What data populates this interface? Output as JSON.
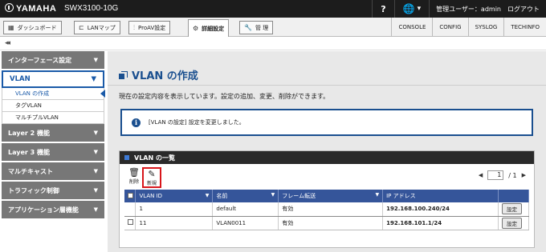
{
  "header": {
    "brand": "YAMAHA",
    "model": "SWX3100-10G",
    "help": "?",
    "user_label": "管理ユーザー：admin",
    "logout": "ログアウト"
  },
  "nav": {
    "tabs": [
      {
        "label": "ダッシュボード",
        "icon": "dashboard-icon"
      },
      {
        "label": "LANマップ",
        "icon": "lan-map-icon"
      },
      {
        "label": "ProAV設定",
        "icon": "sliders-icon"
      },
      {
        "label": "詳細設定",
        "icon": "gear-icon",
        "active": true
      },
      {
        "label": "管 理",
        "icon": "wrench-icon"
      }
    ],
    "links": [
      "CONSOLE",
      "CONFIG",
      "SYSLOG",
      "TECHINFO"
    ]
  },
  "collapse": "◂◂",
  "sidebar": {
    "sections": [
      {
        "label": "インターフェース設定"
      },
      {
        "label": "VLAN"
      },
      {
        "label": "Layer 2 機能"
      },
      {
        "label": "Layer 3 機能"
      },
      {
        "label": "マルチキャスト"
      },
      {
        "label": "トラフィック制御"
      },
      {
        "label": "アプリケーション層機能"
      }
    ],
    "vlan_items": [
      "VLAN の作成",
      "タグVLAN",
      "マルチプルVLAN"
    ]
  },
  "main": {
    "title": "VLAN の作成",
    "description": "現在の設定内容を表示しています。設定の追加、変更、削除ができます。",
    "message": "[VLAN の設定] 設定を変更しました。",
    "panel_title": "VLAN の一覧",
    "toolbar": {
      "delete": "削除",
      "new": "新規"
    },
    "pager": {
      "page": "1",
      "total": "/ 1"
    },
    "table": {
      "headers": [
        "VLAN ID",
        "名前",
        "フレーム転送",
        "IP アドレス"
      ],
      "rows": [
        {
          "vlan_id": "1",
          "name": "default",
          "forward": "有効",
          "ip": "192.168.100.240/24",
          "action": "設定"
        },
        {
          "vlan_id": "11",
          "name": "VLAN0011",
          "forward": "有効",
          "ip": "192.168.101.1/24",
          "action": "設定"
        }
      ]
    }
  }
}
